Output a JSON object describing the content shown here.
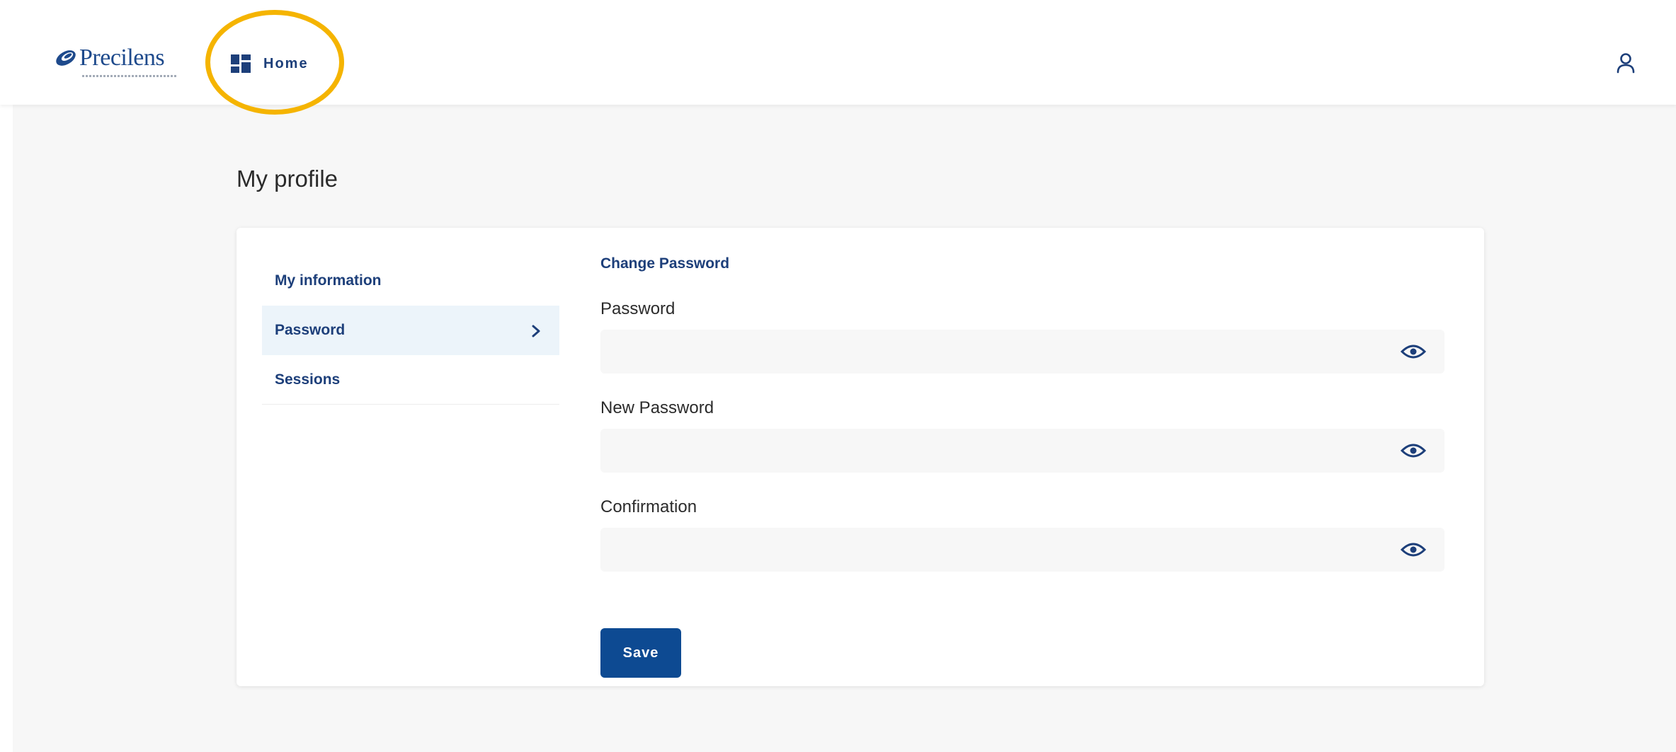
{
  "brand": {
    "name": "Precilens",
    "primary_color": "#0d4a92",
    "link_color": "#1d3f7a",
    "highlight_color": "#f5b400"
  },
  "header": {
    "home_label": "Home",
    "home_icon": "grid-icon",
    "user_icon": "user-icon"
  },
  "page": {
    "title": "My profile"
  },
  "side_menu": {
    "items": [
      {
        "label": "My information",
        "active": false
      },
      {
        "label": "Password",
        "active": true
      },
      {
        "label": "Sessions",
        "active": false
      }
    ]
  },
  "form": {
    "section_title": "Change Password",
    "fields": [
      {
        "label": "Password",
        "value": "",
        "placeholder": ""
      },
      {
        "label": "New Password",
        "value": "",
        "placeholder": ""
      },
      {
        "label": "Confirmation",
        "value": "",
        "placeholder": ""
      }
    ],
    "save_label": "Save"
  }
}
